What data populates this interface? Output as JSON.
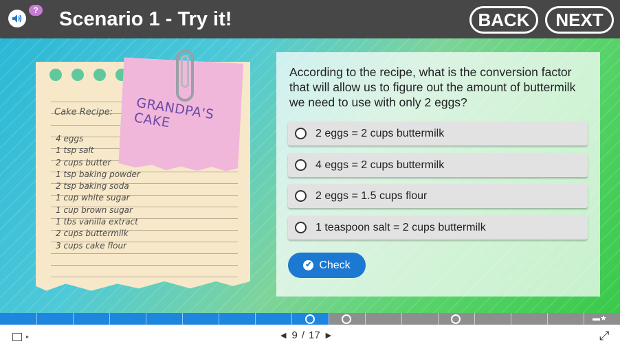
{
  "header": {
    "title": "Scenario 1 - Try it!",
    "back_label": "BACK",
    "next_label": "NEXT",
    "audio_icon": "speaker-icon",
    "help_icon": "help-bubble-icon",
    "help_glyph": "?"
  },
  "recipe": {
    "title": "Cake Recipe:",
    "items": [
      "4 eggs",
      "1 tsp salt",
      "2 cups butter",
      "1 tsp baking powder",
      "2 tsp baking soda",
      "1 cup white sugar",
      "1 cup brown sugar",
      "1 tbs vanilla extract",
      "2 cups buttermilk",
      "3 cups cake flour"
    ],
    "sticky_note": "GRANDPA'S CAKE"
  },
  "quiz": {
    "question": "According to the recipe, what is the conversion factor that will allow us to figure out the amount of buttermilk we need to use with only 2 eggs?",
    "options": [
      "2 eggs = 2 cups buttermilk",
      "4 eggs = 2 cups buttermilk",
      "2 eggs = 1.5 cups flour",
      "1 teaspoon salt = 2 cups buttermilk"
    ],
    "check_label": "Check",
    "check_glyph": "✔"
  },
  "progress": {
    "current": 9,
    "total": 17,
    "fraction_complete": 0.53
  },
  "footer": {
    "page_current": "9",
    "page_separator": "/",
    "page_total": "17",
    "prev_glyph": "◀",
    "next_glyph": "▶",
    "fullscreen_glyph": "⤢"
  },
  "colors": {
    "header_bg": "#474747",
    "accent_blue": "#1d78d1",
    "sticky_pink": "#f0b7db",
    "paper": "#f6e8c8"
  }
}
